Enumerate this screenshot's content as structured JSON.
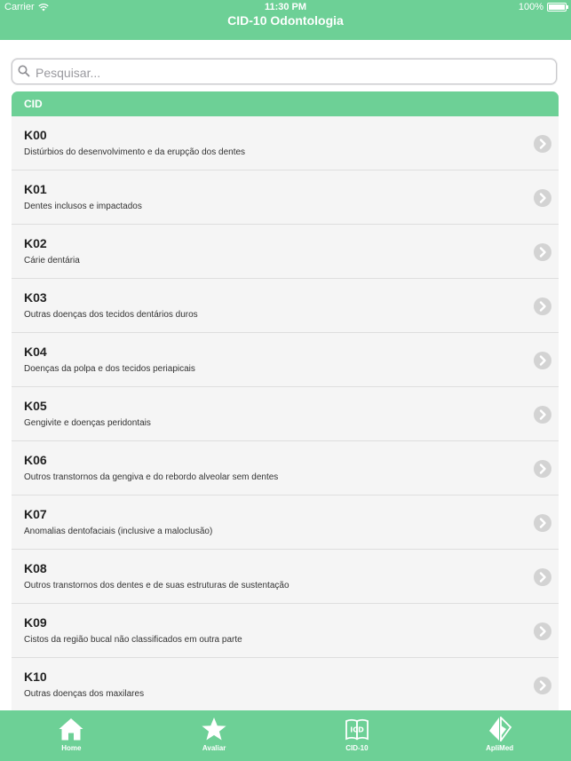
{
  "status": {
    "carrier": "Carrier",
    "time": "11:30 PM",
    "battery": "100%",
    "battery_level": 1.0
  },
  "nav": {
    "title": "CID-10 Odontologia"
  },
  "search": {
    "placeholder": "Pesquisar..."
  },
  "list": {
    "header": "CID",
    "items": [
      {
        "code": "K00",
        "desc": "Distúrbios do desenvolvimento e da erupção dos dentes"
      },
      {
        "code": "K01",
        "desc": "Dentes inclusos e impactados"
      },
      {
        "code": "K02",
        "desc": "Cárie dentária"
      },
      {
        "code": "K03",
        "desc": "Outras doenças dos tecidos dentários duros"
      },
      {
        "code": "K04",
        "desc": "Doenças da polpa e dos tecidos periapicais"
      },
      {
        "code": "K05",
        "desc": "Gengivite e doenças peridontais"
      },
      {
        "code": "K06",
        "desc": "Outros transtornos da gengiva e do rebordo alveolar sem dentes"
      },
      {
        "code": "K07",
        "desc": "Anomalias dentofaciais (inclusive a maloclusão)"
      },
      {
        "code": "K08",
        "desc": "Outros transtornos dos dentes e de suas estruturas de sustentação"
      },
      {
        "code": "K09",
        "desc": "Cistos da região bucal não classificados em outra parte"
      },
      {
        "code": "K10",
        "desc": "Outras doenças dos maxilares"
      }
    ]
  },
  "tabs": [
    {
      "label": "Home",
      "icon": "home-icon"
    },
    {
      "label": "Avaliar",
      "icon": "star-icon"
    },
    {
      "label": "CID-10",
      "icon": "book-icon"
    },
    {
      "label": "ApliMed",
      "icon": "aplimed-logo-icon"
    }
  ],
  "colors": {
    "accent": "#6dd096",
    "row_bg": "#f5f5f5",
    "chevron": "#d3d3d3"
  }
}
